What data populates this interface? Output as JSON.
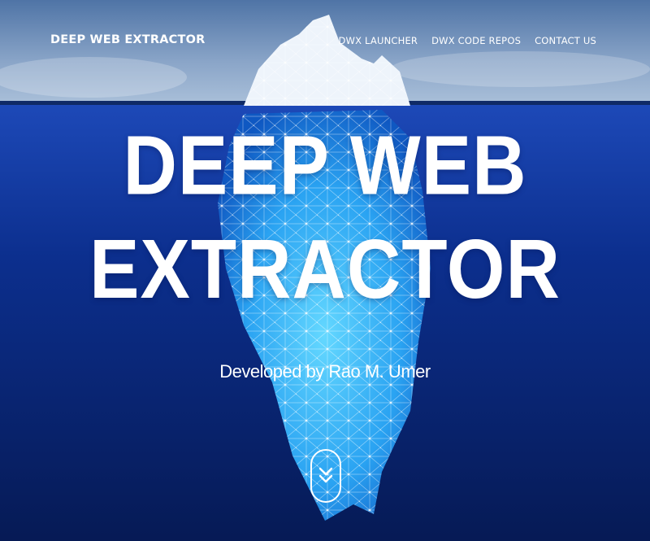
{
  "nav": {
    "brand": "DEEP WEB EXTRACTOR",
    "links": [
      "DWX LAUNCHER",
      "DWX CODE REPOS",
      "CONTACT US"
    ]
  },
  "hero": {
    "title_line1": "DEEP WEB",
    "title_line2": "EXTRACTOR",
    "subtitle": "Developed by Rao M. Umer"
  },
  "icons": {
    "scroll_down": "double-chevron-down-icon"
  },
  "colors": {
    "sky": "#6f8fb8",
    "ocean": "#0b2a7a",
    "iceberg": "#3fb2ff",
    "text": "#ffffff"
  }
}
